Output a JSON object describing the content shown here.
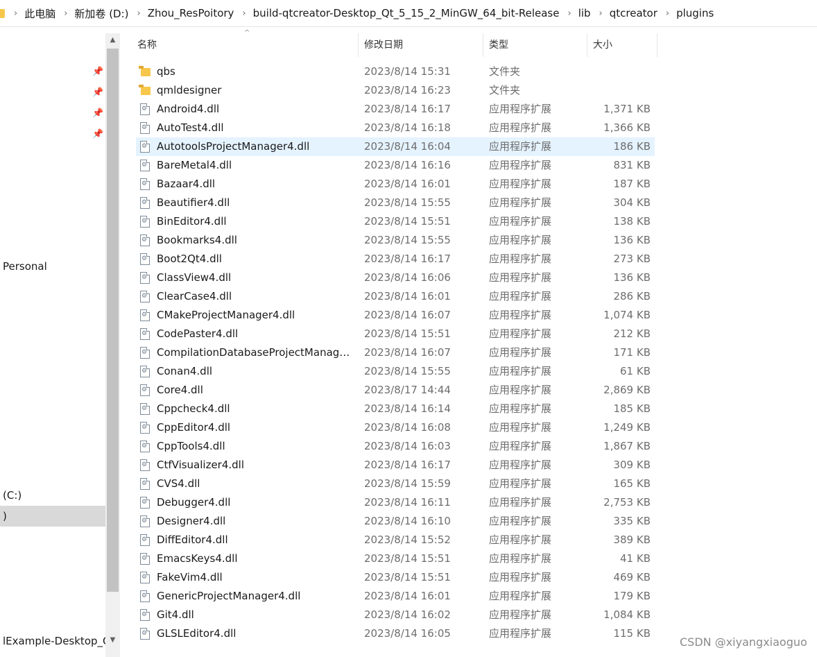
{
  "addressbar": {
    "crumbs": [
      "此电脑",
      "新加卷 (D:)",
      "Zhou_ResPoitory",
      "build-qtcreator-Desktop_Qt_5_15_2_MinGW_64_bit-Release",
      "lib",
      "qtcreator",
      "plugins"
    ],
    "separator": "›"
  },
  "nav": {
    "pin_icon": "📌",
    "items": [
      {
        "label": "Personal"
      },
      {
        "label": "(C:)"
      },
      {
        "label": ")"
      },
      {
        "label": "lExample-Desktop_Qt"
      }
    ],
    "scroll_up": "▲",
    "scroll_down": "▼"
  },
  "columns": {
    "name": "名称",
    "date": "修改日期",
    "type": "类型",
    "size": "大小",
    "sort_indicator": "^"
  },
  "files": [
    {
      "icon": "folder",
      "name": "qbs",
      "date": "2023/8/14 15:31",
      "type": "文件夹",
      "size": ""
    },
    {
      "icon": "folder",
      "name": "qmldesigner",
      "date": "2023/8/14 16:23",
      "type": "文件夹",
      "size": ""
    },
    {
      "icon": "dll",
      "name": "Android4.dll",
      "date": "2023/8/14 16:17",
      "type": "应用程序扩展",
      "size": "1,371 KB"
    },
    {
      "icon": "dll",
      "name": "AutoTest4.dll",
      "date": "2023/8/14 16:18",
      "type": "应用程序扩展",
      "size": "1,366 KB"
    },
    {
      "icon": "dll",
      "name": "AutotoolsProjectManager4.dll",
      "date": "2023/8/14 16:04",
      "type": "应用程序扩展",
      "size": "186 KB",
      "selected": true
    },
    {
      "icon": "dll",
      "name": "BareMetal4.dll",
      "date": "2023/8/14 16:16",
      "type": "应用程序扩展",
      "size": "831 KB"
    },
    {
      "icon": "dll",
      "name": "Bazaar4.dll",
      "date": "2023/8/14 16:01",
      "type": "应用程序扩展",
      "size": "187 KB"
    },
    {
      "icon": "dll",
      "name": "Beautifier4.dll",
      "date": "2023/8/14 15:55",
      "type": "应用程序扩展",
      "size": "304 KB"
    },
    {
      "icon": "dll",
      "name": "BinEditor4.dll",
      "date": "2023/8/14 15:51",
      "type": "应用程序扩展",
      "size": "138 KB"
    },
    {
      "icon": "dll",
      "name": "Bookmarks4.dll",
      "date": "2023/8/14 15:55",
      "type": "应用程序扩展",
      "size": "136 KB"
    },
    {
      "icon": "dll",
      "name": "Boot2Qt4.dll",
      "date": "2023/8/14 16:17",
      "type": "应用程序扩展",
      "size": "273 KB"
    },
    {
      "icon": "dll",
      "name": "ClassView4.dll",
      "date": "2023/8/14 16:06",
      "type": "应用程序扩展",
      "size": "136 KB"
    },
    {
      "icon": "dll",
      "name": "ClearCase4.dll",
      "date": "2023/8/14 16:01",
      "type": "应用程序扩展",
      "size": "286 KB"
    },
    {
      "icon": "dll",
      "name": "CMakeProjectManager4.dll",
      "date": "2023/8/14 16:07",
      "type": "应用程序扩展",
      "size": "1,074 KB"
    },
    {
      "icon": "dll",
      "name": "CodePaster4.dll",
      "date": "2023/8/14 15:51",
      "type": "应用程序扩展",
      "size": "212 KB"
    },
    {
      "icon": "dll",
      "name": "CompilationDatabaseProjectManage...",
      "date": "2023/8/14 16:07",
      "type": "应用程序扩展",
      "size": "171 KB"
    },
    {
      "icon": "dll",
      "name": "Conan4.dll",
      "date": "2023/8/14 15:55",
      "type": "应用程序扩展",
      "size": "61 KB"
    },
    {
      "icon": "dll",
      "name": "Core4.dll",
      "date": "2023/8/17 14:44",
      "type": "应用程序扩展",
      "size": "2,869 KB"
    },
    {
      "icon": "dll",
      "name": "Cppcheck4.dll",
      "date": "2023/8/14 16:14",
      "type": "应用程序扩展",
      "size": "185 KB"
    },
    {
      "icon": "dll",
      "name": "CppEditor4.dll",
      "date": "2023/8/14 16:08",
      "type": "应用程序扩展",
      "size": "1,249 KB"
    },
    {
      "icon": "dll",
      "name": "CppTools4.dll",
      "date": "2023/8/14 16:03",
      "type": "应用程序扩展",
      "size": "1,867 KB"
    },
    {
      "icon": "dll",
      "name": "CtfVisualizer4.dll",
      "date": "2023/8/14 16:17",
      "type": "应用程序扩展",
      "size": "309 KB"
    },
    {
      "icon": "dll",
      "name": "CVS4.dll",
      "date": "2023/8/14 15:59",
      "type": "应用程序扩展",
      "size": "165 KB"
    },
    {
      "icon": "dll",
      "name": "Debugger4.dll",
      "date": "2023/8/14 16:11",
      "type": "应用程序扩展",
      "size": "2,753 KB"
    },
    {
      "icon": "dll",
      "name": "Designer4.dll",
      "date": "2023/8/14 16:10",
      "type": "应用程序扩展",
      "size": "335 KB"
    },
    {
      "icon": "dll",
      "name": "DiffEditor4.dll",
      "date": "2023/8/14 15:52",
      "type": "应用程序扩展",
      "size": "389 KB"
    },
    {
      "icon": "dll",
      "name": "EmacsKeys4.dll",
      "date": "2023/8/14 15:51",
      "type": "应用程序扩展",
      "size": "41 KB"
    },
    {
      "icon": "dll",
      "name": "FakeVim4.dll",
      "date": "2023/8/14 15:51",
      "type": "应用程序扩展",
      "size": "469 KB"
    },
    {
      "icon": "dll",
      "name": "GenericProjectManager4.dll",
      "date": "2023/8/14 16:01",
      "type": "应用程序扩展",
      "size": "179 KB"
    },
    {
      "icon": "dll",
      "name": "Git4.dll",
      "date": "2023/8/14 16:02",
      "type": "应用程序扩展",
      "size": "1,084 KB"
    },
    {
      "icon": "dll",
      "name": "GLSLEditor4.dll",
      "date": "2023/8/14 16:05",
      "type": "应用程序扩展",
      "size": "115 KB"
    }
  ],
  "watermark": "CSDN @xiyangxiaoguo"
}
